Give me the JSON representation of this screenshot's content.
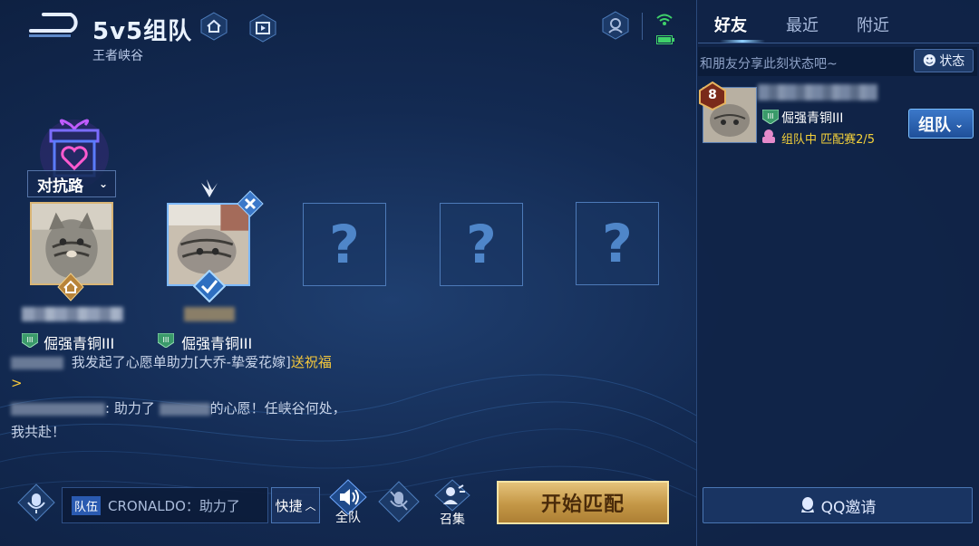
{
  "header": {
    "title": "5v5组队",
    "subtitle": "王者峡谷"
  },
  "team": {
    "lane_label": "对抗路",
    "slots": [
      {
        "type": "player",
        "host": true,
        "rank": "倔强青铜III"
      },
      {
        "type": "player",
        "ready": true,
        "rank": "倔强青铜III"
      },
      {
        "type": "empty",
        "symbol": "?"
      },
      {
        "type": "empty",
        "symbol": "?"
      },
      {
        "type": "empty",
        "symbol": "?"
      }
    ]
  },
  "chat": {
    "line1_text": "我发起了心愿单助力[大乔-挚爱花嫁]",
    "line1_link": "送祝福",
    "line1_arrow": ">",
    "line2_a": ": 助力了",
    "line2_b": "的心愿！任峡谷何处，",
    "line3": "我共赴！"
  },
  "bottom_bar": {
    "channel_tag": "队伍",
    "input_value": "CRONALDO：助力了",
    "quick_label": "快捷",
    "all_team_label": "全队",
    "summon_label": "召集",
    "start_label": "开始匹配"
  },
  "friends_panel": {
    "tabs": [
      "好友",
      "最近",
      "附近"
    ],
    "active_tab": "好友",
    "status_placeholder": "和朋友分享此刻状态吧~",
    "status_button": "状态",
    "friend": {
      "level": "8",
      "rank": "倔强青铜III",
      "status": "组队中 匹配赛2/5",
      "invite_label": "组队"
    },
    "qq_invite_label": "QQ邀请"
  },
  "colors": {
    "accent_gold": "#f7c93b",
    "start_button": "#d6b063",
    "panel_bg": "#10244a",
    "empty_slot_border": "#4d7ab8"
  },
  "icons": [
    "back-icon",
    "home-icon",
    "replay-icon",
    "hero-icon",
    "wifi-icon",
    "battery-icon",
    "gift-heart-icon",
    "house-icon",
    "check-icon",
    "close-icon",
    "wing-icon",
    "voice-icon",
    "speaker-icon",
    "mic-muted-icon",
    "summon-icon",
    "qq-icon",
    "emoji-icon",
    "chevron-down-icon",
    "chevron-up-icon"
  ]
}
